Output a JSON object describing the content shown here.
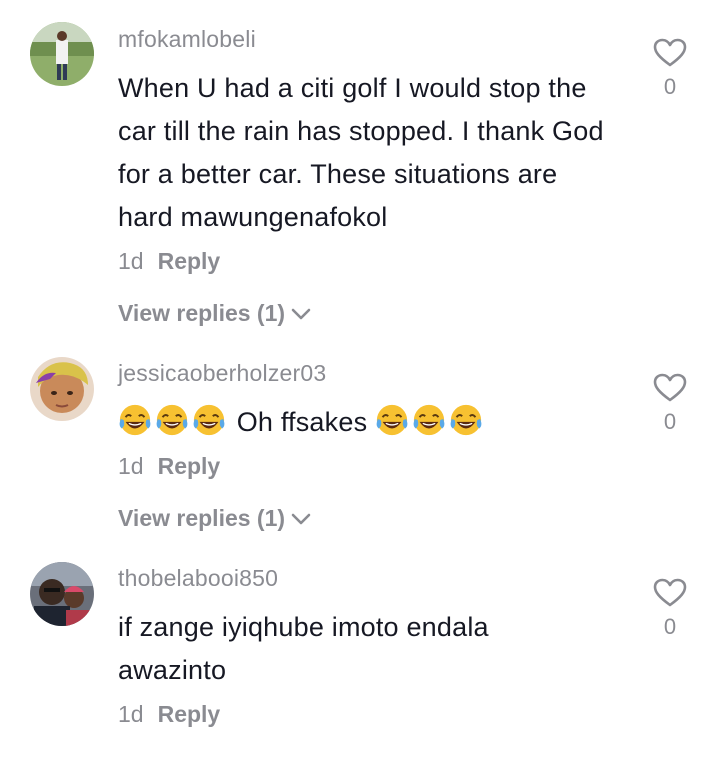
{
  "comments": [
    {
      "username": "mfokamlobeli",
      "text": "When U had a citi golf I would stop the car till the rain has stopped. I thank God for a better car. These situations are hard mawungenafokol",
      "time": "1d",
      "reply_label": "Reply",
      "view_replies": "View replies (1)",
      "like_count": "0"
    },
    {
      "username": "jessicaoberholzer03",
      "text": "Oh ffsakes",
      "emoji_before": [
        "face-with-tears-of-joy",
        "face-with-tears-of-joy",
        "face-with-tears-of-joy"
      ],
      "emoji_after": [
        "face-with-tears-of-joy",
        "face-with-tears-of-joy",
        "face-with-tears-of-joy"
      ],
      "time": "1d",
      "reply_label": "Reply",
      "view_replies": "View replies (1)",
      "like_count": "0"
    },
    {
      "username": "thobelabooi850",
      "text": "if zange iyiqhube imoto endala awazinto",
      "time": "1d",
      "reply_label": "Reply",
      "like_count": "0"
    }
  ],
  "icons": {
    "like": "heart-outline-icon",
    "expand": "chevron-down-icon"
  },
  "colors": {
    "text_primary": "#161823",
    "text_secondary": "#8a8b91",
    "background": "#ffffff"
  }
}
